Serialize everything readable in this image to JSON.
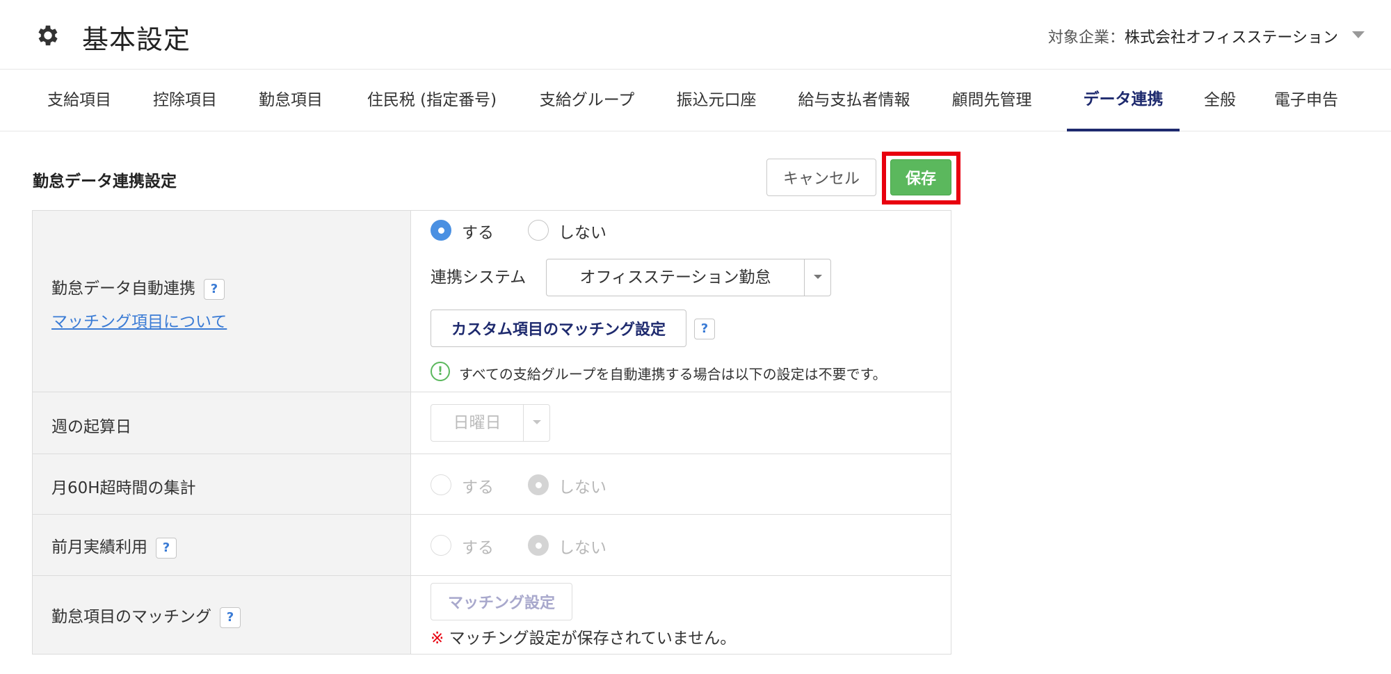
{
  "header": {
    "title": "基本設定",
    "icon": "gear-icon",
    "company_label": "対象企業：",
    "company_name": "株式会社オフィスステーション"
  },
  "tabs": [
    {
      "label": "支給項目"
    },
    {
      "label": "控除項目"
    },
    {
      "label": "勤怠項目"
    },
    {
      "label": "住民税 (指定番号)"
    },
    {
      "label": "支給グループ"
    },
    {
      "label": "振込元口座"
    },
    {
      "label": "給与支払者情報"
    },
    {
      "label": "顧問先管理"
    },
    {
      "label": "データ連携",
      "active": true
    },
    {
      "label": "全般"
    },
    {
      "label": "電子申告"
    }
  ],
  "section": {
    "title": "勤怠データ連携設定",
    "cancel_label": "キャンセル",
    "save_label": "保存",
    "highlight_color": "#e8000f"
  },
  "rows": {
    "auto_link": {
      "label": "勤怠データ自動連携",
      "help": "?",
      "link": "マッチング項目について",
      "yes": "する",
      "no": "しない",
      "selected": "する",
      "system_label": "連携システム",
      "system_value": "オフィスステーション勤怠",
      "custom_button": "カスタム項目のマッチング設定",
      "info_icon": "!",
      "info": "すべての支給グループを自動連携する場合は以下の設定は不要です。"
    },
    "week_start": {
      "label": "週の起算日",
      "value": "日曜日"
    },
    "over60": {
      "label": "月60H超時間の集計",
      "yes": "する",
      "no": "しない",
      "selected": "しない"
    },
    "prev_month": {
      "label": "前月実績利用",
      "help": "?",
      "yes": "する",
      "no": "しない",
      "selected": "しない"
    },
    "matching": {
      "label": "勤怠項目のマッチング",
      "help": "?",
      "button": "マッチング設定",
      "warn_mark": "※",
      "warn": " マッチング設定が保存されていません。"
    }
  },
  "colors": {
    "accent": "#1e2a6e",
    "save": "#5bb85d",
    "link": "#3a7bd5"
  }
}
